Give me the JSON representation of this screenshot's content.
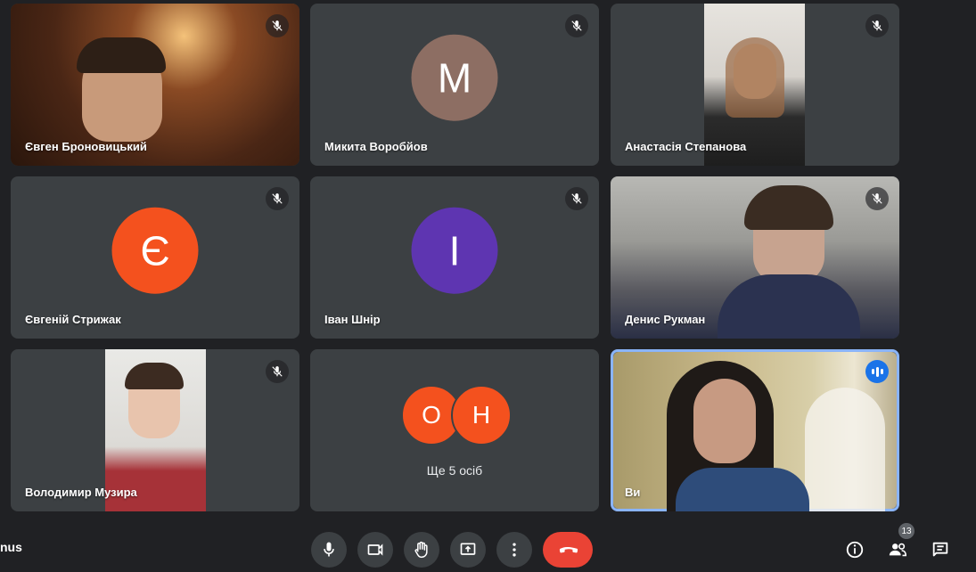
{
  "participants": [
    {
      "name": "Євген Броновицький",
      "muted": true
    },
    {
      "name": "Микита Воробйов",
      "initial": "М",
      "color": "#8d6e63",
      "muted": true
    },
    {
      "name": "Анастасія Степанова",
      "muted": true
    },
    {
      "name": "Євгеній Стрижак",
      "initial": "Є",
      "color": "#f4511e",
      "muted": true
    },
    {
      "name": "Іван Шнір",
      "initial": "І",
      "color": "#5e35b1",
      "muted": true
    },
    {
      "name": "Денис Рукман",
      "muted": true
    },
    {
      "name": "Володимир Музира",
      "muted": true
    }
  ],
  "more": {
    "initials": [
      "О",
      "Н"
    ],
    "label": "Ще 5 осіб"
  },
  "self": {
    "name": "Ви",
    "speaking": true
  },
  "meeting": {
    "label_fragment": "nus"
  },
  "toolbar": {
    "mic_icon": "mic-icon",
    "camera_icon": "videocam-icon",
    "hand_icon": "raise-hand-icon",
    "present_icon": "present-screen-icon",
    "more_icon": "more-vert-icon",
    "leave_icon": "call-end-icon"
  },
  "side_controls": {
    "participants_count": "13"
  },
  "colors": {
    "background": "#202124",
    "tile": "#3c4043",
    "leave": "#ea4335",
    "active_border": "#8ab4f8",
    "speaking": "#1a73e8"
  }
}
